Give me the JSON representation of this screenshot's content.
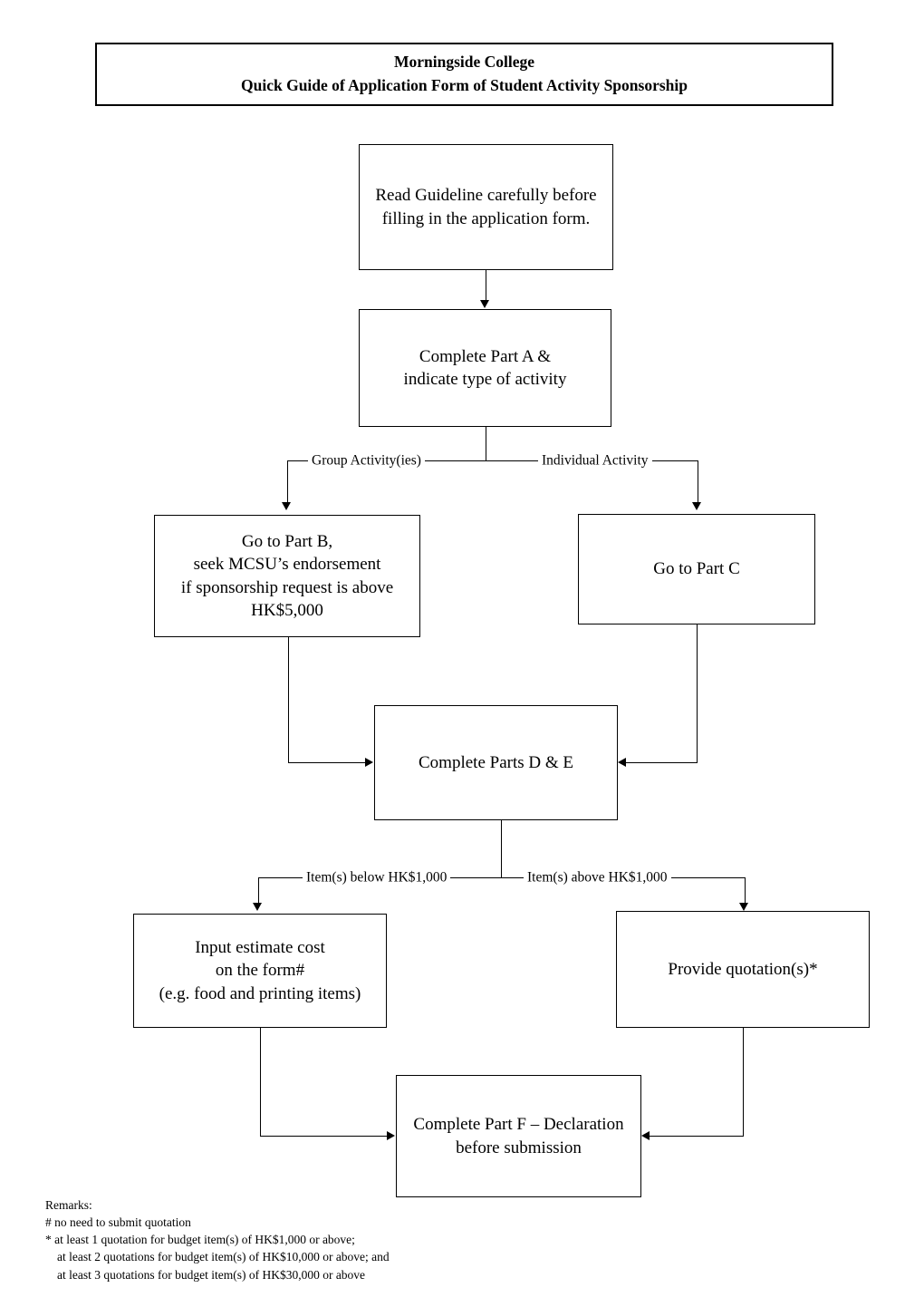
{
  "header": {
    "line1": "Morningside College",
    "line2": "Quick Guide of Application Form of Student Activity Sponsorship"
  },
  "nodes": {
    "read_guideline": "Read Guideline carefully before\nfilling in the application form.",
    "part_a": "Complete Part A &\nindicate type of activity",
    "part_b": "Go to Part B,\nseek MCSU’s endorsement\nif sponsorship request is above\nHK$5,000",
    "part_c": "Go to Part C",
    "parts_d_e": "Complete Parts D & E",
    "estimate_cost": "Input estimate cost\non the form#\n(e.g. food and printing items)",
    "provide_quotation": "Provide quotation(s)*",
    "part_f": "Complete Part F – Declaration\nbefore submission"
  },
  "branches": {
    "activity_group": "Group Activity(ies)",
    "activity_individual": "Individual Activity",
    "items_below": "Item(s) below HK$1,000",
    "items_above": "Item(s) above HK$1,000"
  },
  "remarks": {
    "title": "Remarks:",
    "hash_note": "# no need to submit quotation",
    "star_note_1": "* at least 1 quotation for budget item(s) of HK$1,000 or above;",
    "star_note_2": "at least 2 quotations for budget item(s) of HK$10,000 or above; and",
    "star_note_3": "at least 3 quotations for budget item(s) of HK$30,000 or above"
  },
  "colors": {
    "ink": "#000000",
    "page": "#ffffff"
  }
}
